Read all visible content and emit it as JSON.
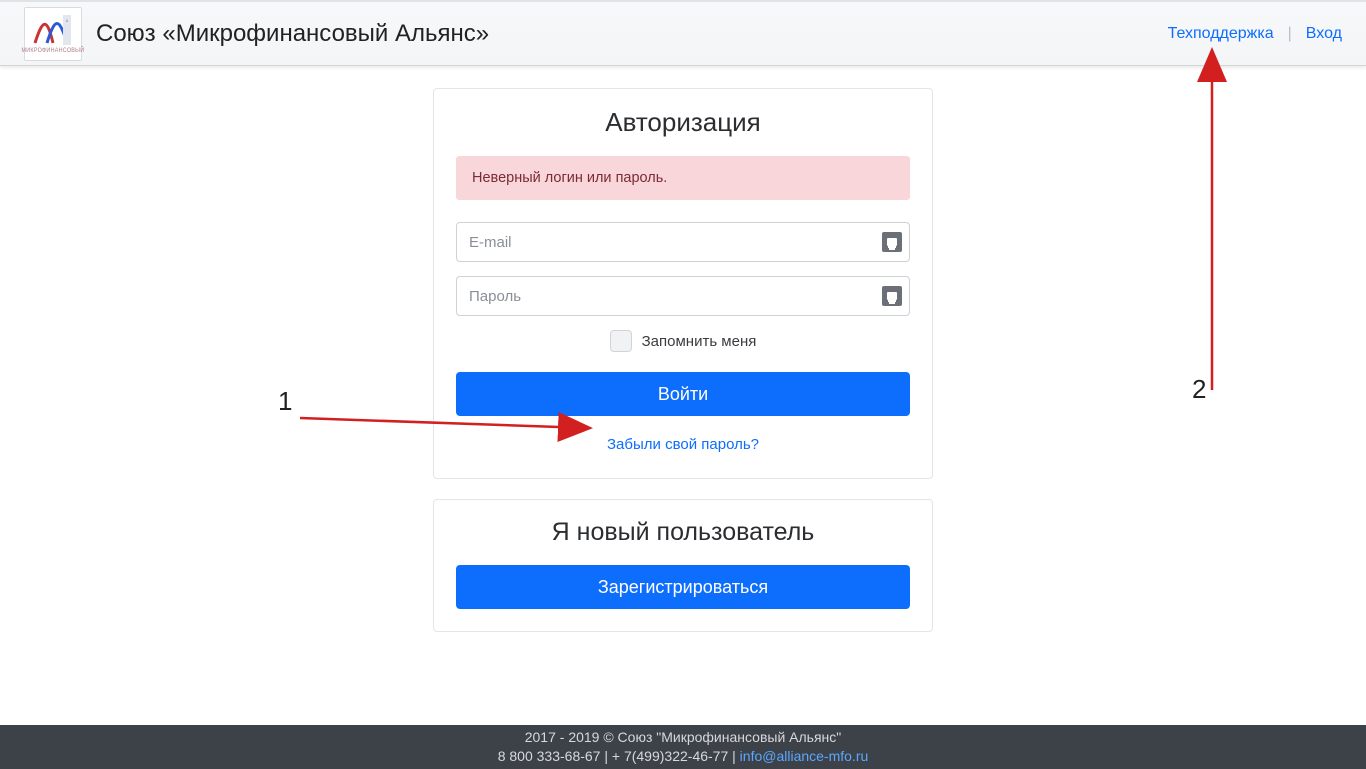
{
  "header": {
    "brand_title": "Союз «Микрофинансовый Альянс»",
    "logo_caption": "МИКРОФИНАНСОВЫЙ",
    "nav": {
      "support": "Техподдержка",
      "login": "Вход"
    }
  },
  "auth": {
    "title": "Авторизация",
    "error": "Неверный логин или пароль.",
    "email_placeholder": "E-mail",
    "password_placeholder": "Пароль",
    "remember": "Запомнить меня",
    "submit": "Войти",
    "forgot": "Забыли свой пароль?"
  },
  "register": {
    "title": "Я новый пользователь",
    "button": "Зарегистрироваться"
  },
  "footer": {
    "line1": "2017 - 2019 © Союз \"Микрофинансовый Альянс\"",
    "phones": "8 800 333-68-67 | + 7(499)322-46-77 | ",
    "email": "info@alliance-mfo.ru"
  },
  "annotations": {
    "one": "1",
    "two": "2"
  }
}
